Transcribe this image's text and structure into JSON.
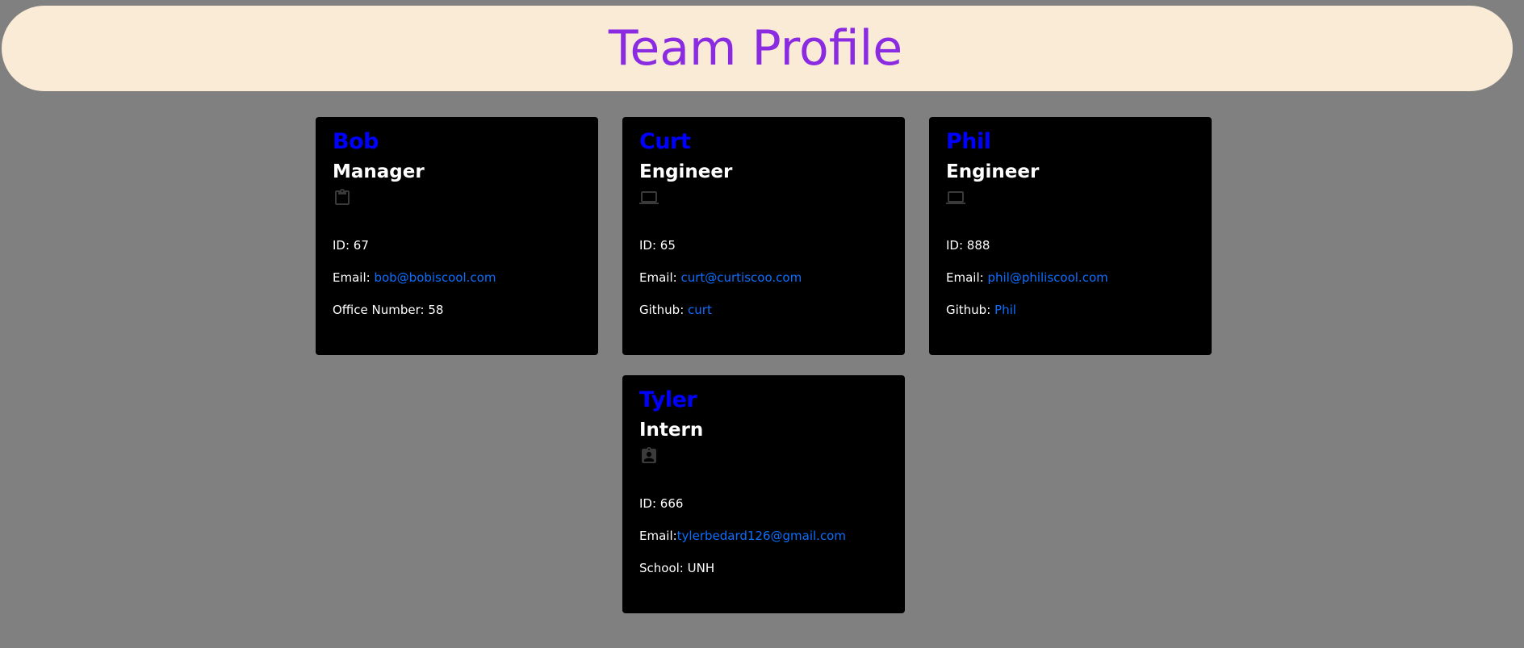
{
  "header": {
    "title": "Team Profile"
  },
  "colors": {
    "page_background": "#808080",
    "header_background": "#faebd7",
    "title_color": "#8a2be2",
    "card_background": "#000000",
    "name_color": "#0000ff",
    "link_color": "#0d6efd",
    "icon_color": "#3a3a3a"
  },
  "cards": [
    {
      "name": "Bob",
      "role": "Manager",
      "icon": "clipboard-icon",
      "id_label": "ID: ",
      "id": "67",
      "email_label": "Email: ",
      "email": "bob@bobiscool.com",
      "extra_label": "Office Number: ",
      "extra_value": "58"
    },
    {
      "name": "Curt",
      "role": "Engineer",
      "icon": "laptop-icon",
      "id_label": "ID: ",
      "id": "65",
      "email_label": "Email: ",
      "email": "curt@curtiscoo.com",
      "extra_label": "Github: ",
      "extra_value": "curt"
    },
    {
      "name": "Phil",
      "role": "Engineer",
      "icon": "laptop-icon",
      "id_label": "ID: ",
      "id": "888",
      "email_label": "Email: ",
      "email": "phil@philiscool.com",
      "extra_label": "Github: ",
      "extra_value": "Phil"
    },
    {
      "name": "Tyler",
      "role": "Intern",
      "icon": "student-badge-icon",
      "id_label": "ID: ",
      "id": "666",
      "email_label": "Email:",
      "email": "tylerbedard126@gmail.com",
      "extra_label": "School: ",
      "extra_value": "UNH"
    }
  ]
}
